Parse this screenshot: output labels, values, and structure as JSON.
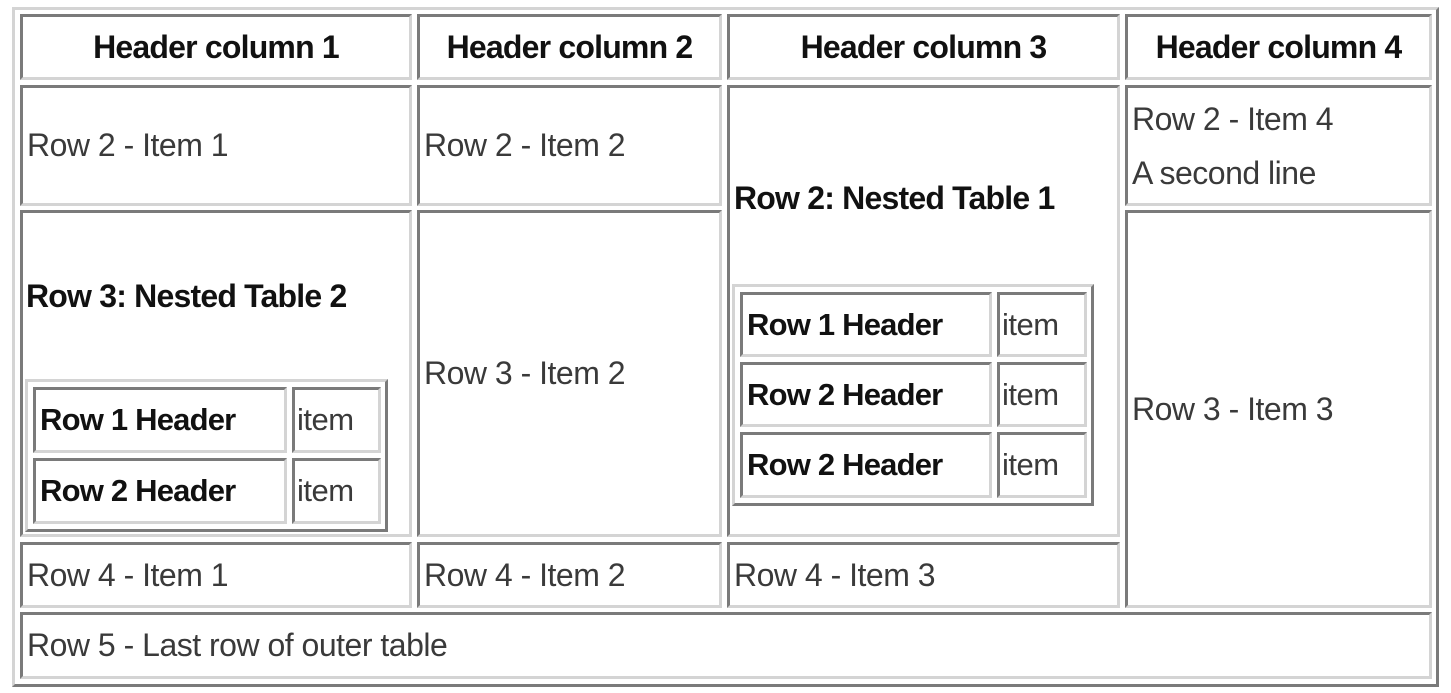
{
  "outer_table": {
    "headers": [
      "Header column 1",
      "Header column 2",
      "Header column 3",
      "Header column 4"
    ],
    "row2": {
      "item1": "Row 2 - Item 1",
      "item2": "Row 2 - Item 2",
      "item4_lines": [
        "Row 2 - Item 4",
        "A second line"
      ]
    },
    "row3": {
      "item2": "Row 3 - Item 2",
      "item3": "Row 3 - Item 3"
    },
    "row4": {
      "item1": "Row 4 - Item 1",
      "item2": "Row 4 - Item 2",
      "item3": "Row 4 - Item 3"
    },
    "row5": {
      "text": "Row 5 - Last row of outer table"
    }
  },
  "nested_table_1": {
    "caption": "Row 2: Nested Table 1",
    "rows": [
      {
        "header": "Row 1 Header",
        "value": "item"
      },
      {
        "header": "Row 2 Header",
        "value": "item"
      },
      {
        "header": "Row 2 Header",
        "value": "item"
      }
    ]
  },
  "nested_table_2": {
    "caption": "Row 3: Nested Table 2",
    "rows": [
      {
        "header": "Row 1 Header",
        "value": "item"
      },
      {
        "header": "Row 2 Header",
        "value": "item"
      }
    ]
  }
}
